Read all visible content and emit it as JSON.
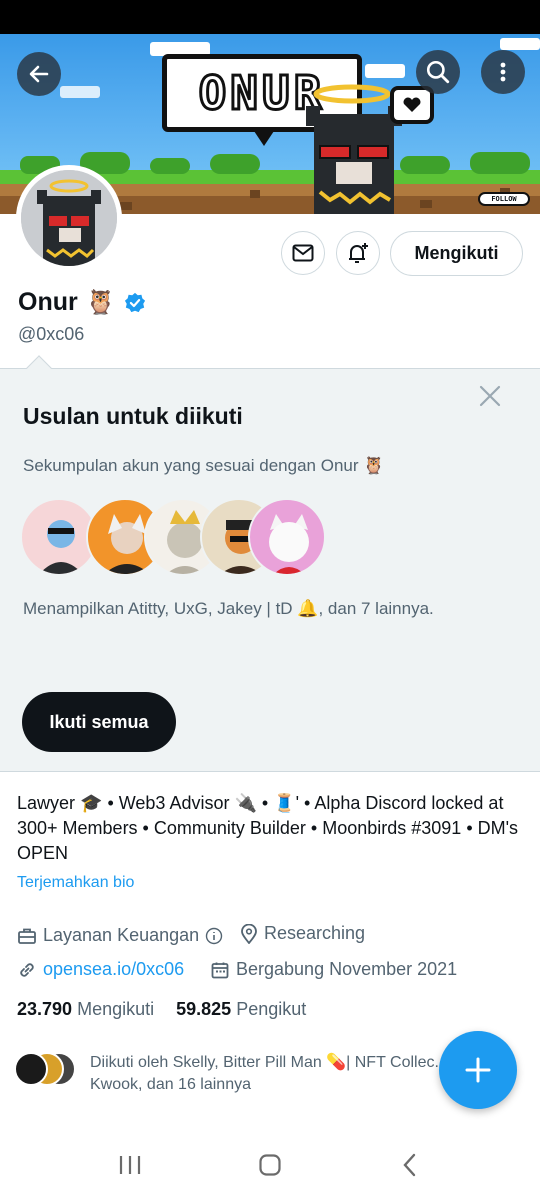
{
  "banner": {
    "speech_text": "ONUR",
    "follow_tag": "FOLLOW",
    "back_icon": "arrow-left-icon",
    "search_icon": "search-icon",
    "more_icon": "more-vertical-icon"
  },
  "profile": {
    "display_name": "Onur",
    "name_emoji": "🦉",
    "handle": "@0xc06",
    "following_button": "Mengikuti",
    "message_icon": "envelope-icon",
    "notify_icon": "bell-plus-icon"
  },
  "suggestions": {
    "title": "Usulan untuk diikuti",
    "subtitle": "Sekumpulan akun yang sesuai dengan Onur 🦉",
    "description": "Menampilkan Atitty, UxG, Jakey | tD 🔔, dan 7 lainnya.",
    "follow_all_button": "Ikuti semua",
    "close_icon": "close-icon"
  },
  "bio": {
    "text": "Lawyer 🎓 • Web3 Advisor 🔌 • 🧵' • Alpha Discord locked at 300+ Members • Community Builder • Moonbirds #3091 • DM's OPEN",
    "translate_link": "Terjemahkan bio"
  },
  "meta": {
    "category": "Layanan Keuangan",
    "location": "Researching",
    "website": "opensea.io/0xc06",
    "joined": "Bergabung November 2021"
  },
  "stats": {
    "following_count": "23.790",
    "following_label": "Mengikuti",
    "followers_count": "59.825",
    "followers_label": "Pengikut"
  },
  "followed_by": {
    "text": "Diikuti oleh Skelly, Bitter Pill Man 💊| NFT Collec...",
    "text_line2": "Kwook, dan 16 lainnya"
  },
  "colors": {
    "accent": "#1d9bf0",
    "text_primary": "#0f1419",
    "text_secondary": "#536471",
    "card_background": "#eff3f4"
  }
}
